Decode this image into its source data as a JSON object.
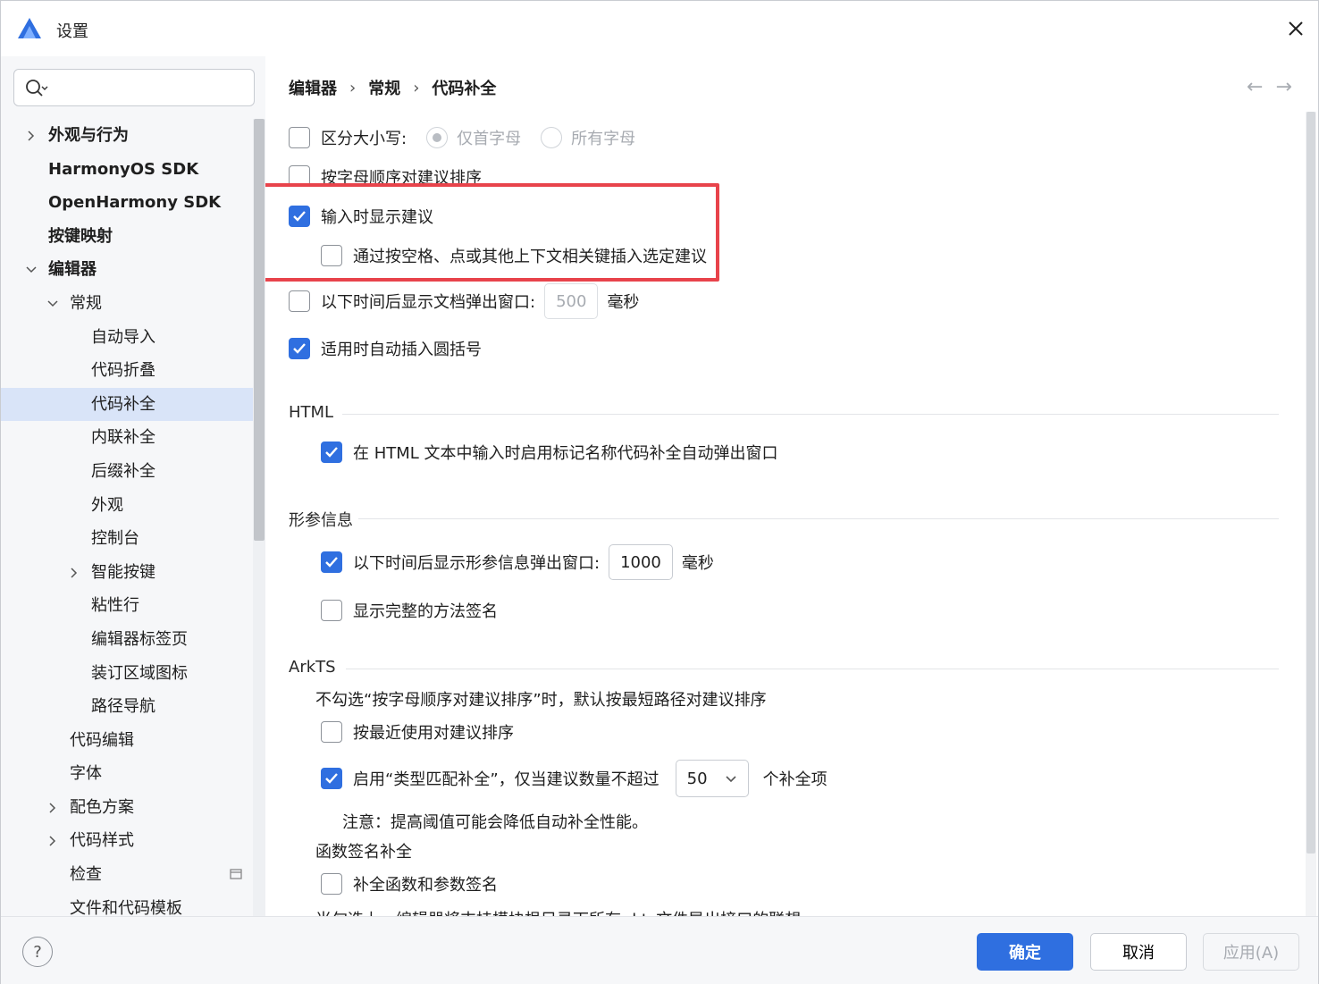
{
  "window": {
    "title": "设置"
  },
  "search": {
    "placeholder": "",
    "value": ""
  },
  "sidebar": {
    "items": [
      {
        "label": "外观与行为",
        "bold": true,
        "chevron": "right"
      },
      {
        "label": "HarmonyOS SDK",
        "bold": true
      },
      {
        "label": "OpenHarmony SDK",
        "bold": true
      },
      {
        "label": "按键映射",
        "bold": true
      },
      {
        "label": "编辑器",
        "bold": true,
        "chevron": "down"
      },
      {
        "label": "常规",
        "chevron": "down"
      },
      {
        "label": "自动导入"
      },
      {
        "label": "代码折叠"
      },
      {
        "label": "代码补全",
        "selected": true
      },
      {
        "label": "内联补全"
      },
      {
        "label": "后缀补全"
      },
      {
        "label": "外观"
      },
      {
        "label": "控制台"
      },
      {
        "label": "智能按键",
        "chevron": "right"
      },
      {
        "label": "粘性行"
      },
      {
        "label": "编辑器标签页"
      },
      {
        "label": "装订区域图标"
      },
      {
        "label": "路径导航"
      },
      {
        "label": "代码编辑"
      },
      {
        "label": "字体"
      },
      {
        "label": "配色方案",
        "chevron": "right"
      },
      {
        "label": "代码样式",
        "chevron": "right"
      },
      {
        "label": "检查",
        "pin": true
      },
      {
        "label": "文件和代码模板"
      }
    ]
  },
  "breadcrumb": [
    "编辑器",
    "常规",
    "代码补全"
  ],
  "options": {
    "case_sensitive": {
      "label": "区分大小写:",
      "checked": false,
      "radio1": "仅首字母",
      "radio2": "所有字母"
    },
    "sort_alpha": {
      "label": "按字母顺序对建议排序",
      "checked": false
    },
    "show_suggestions": {
      "label": "输入时显示建议",
      "checked": true
    },
    "insert_selected": {
      "label": "通过按空格、点或其他上下文相关键插入选定建议",
      "checked": false
    },
    "doc_popup": {
      "label": "以下时间后显示文档弹出窗口:",
      "checked": false,
      "value": "500",
      "unit": "毫秒"
    },
    "auto_parens": {
      "label": "适用时自动插入圆括号",
      "checked": true
    }
  },
  "html_section": {
    "title": "HTML",
    "tag_popup": {
      "label": "在 HTML 文本中输入时启用标记名称代码补全自动弹出窗口",
      "checked": true
    }
  },
  "param_section": {
    "title": "形参信息",
    "param_popup": {
      "label": "以下时间后显示形参信息弹出窗口:",
      "checked": true,
      "value": "1000",
      "unit": "毫秒"
    },
    "full_signature": {
      "label": "显示完整的方法签名",
      "checked": false
    }
  },
  "arkts_section": {
    "title": "ArkTS",
    "description": "不勾选“按字母顺序对建议排序”时，默认按最短路径对建议排序",
    "recent_sort": {
      "label": "按最近使用对建议排序",
      "checked": false
    },
    "type_match": {
      "label": "启用“类型匹配补全”，仅当建议数量不超过",
      "checked": true,
      "value": "50",
      "unit": "个补全项"
    },
    "note": "注意：提高阈值可能会降低自动补全性能。",
    "signature_title": "函数签名补全",
    "complete_signature": {
      "label": "补全函数和参数签名",
      "checked": false
    },
    "cut_text": "当勾选上，编辑器将支持模块根目录下所有.d.ts文件导出接口的联想"
  },
  "footer": {
    "help": "?",
    "ok": "确定",
    "cancel": "取消",
    "apply": "应用(A)"
  },
  "colors": {
    "accent": "#2f6fe0",
    "highlight": "#e8434b",
    "selected_bg": "#d9e4f8"
  }
}
